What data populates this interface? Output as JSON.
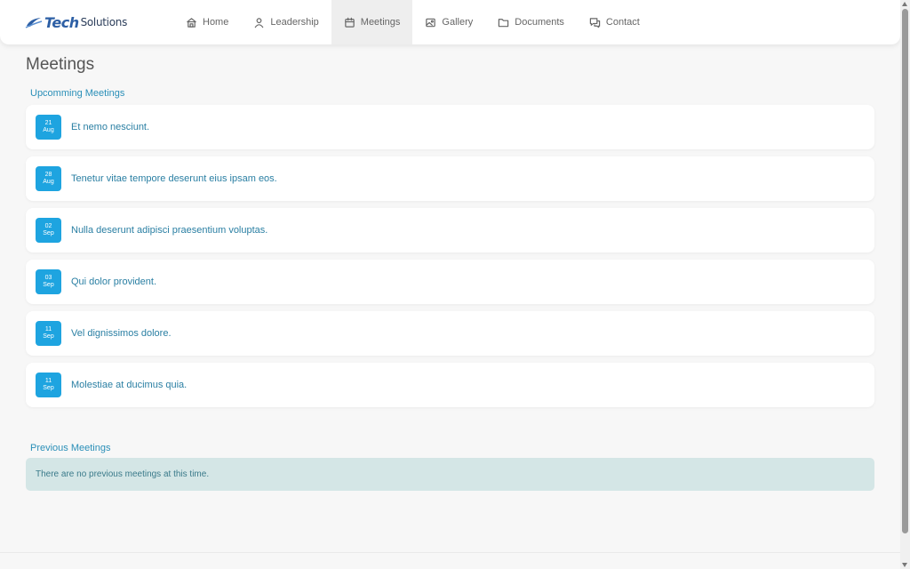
{
  "brand": {
    "name_bold": "Tech",
    "name_rest": "Solutions",
    "color": "#2d5fa5"
  },
  "nav": [
    {
      "label": "Home",
      "icon": "home-icon",
      "active": false
    },
    {
      "label": "Leadership",
      "icon": "user-icon",
      "active": false
    },
    {
      "label": "Meetings",
      "icon": "calendar-icon",
      "active": true
    },
    {
      "label": "Gallery",
      "icon": "image-icon",
      "active": false
    },
    {
      "label": "Documents",
      "icon": "folder-icon",
      "active": false
    },
    {
      "label": "Contact",
      "icon": "chat-icon",
      "active": false
    }
  ],
  "page": {
    "title": "Meetings"
  },
  "upcoming": {
    "heading": "Upcomming Meetings",
    "items": [
      {
        "day": "21",
        "month": "Aug",
        "title": "Et nemo nesciunt."
      },
      {
        "day": "28",
        "month": "Aug",
        "title": "Tenetur vitae tempore deserunt eius ipsam eos."
      },
      {
        "day": "02",
        "month": "Sep",
        "title": "Nulla deserunt adipisci praesentium voluptas."
      },
      {
        "day": "03",
        "month": "Sep",
        "title": "Qui dolor provident."
      },
      {
        "day": "11",
        "month": "Sep",
        "title": "Vel dignissimos dolore."
      },
      {
        "day": "11",
        "month": "Sep",
        "title": "Molestiae at ducimus quia."
      }
    ]
  },
  "previous": {
    "heading": "Previous Meetings",
    "empty_message": "There are no previous meetings at this time."
  },
  "colors": {
    "accent": "#1ea4e0",
    "link": "#2a7fa3",
    "notice_bg": "#d4e6e6"
  }
}
